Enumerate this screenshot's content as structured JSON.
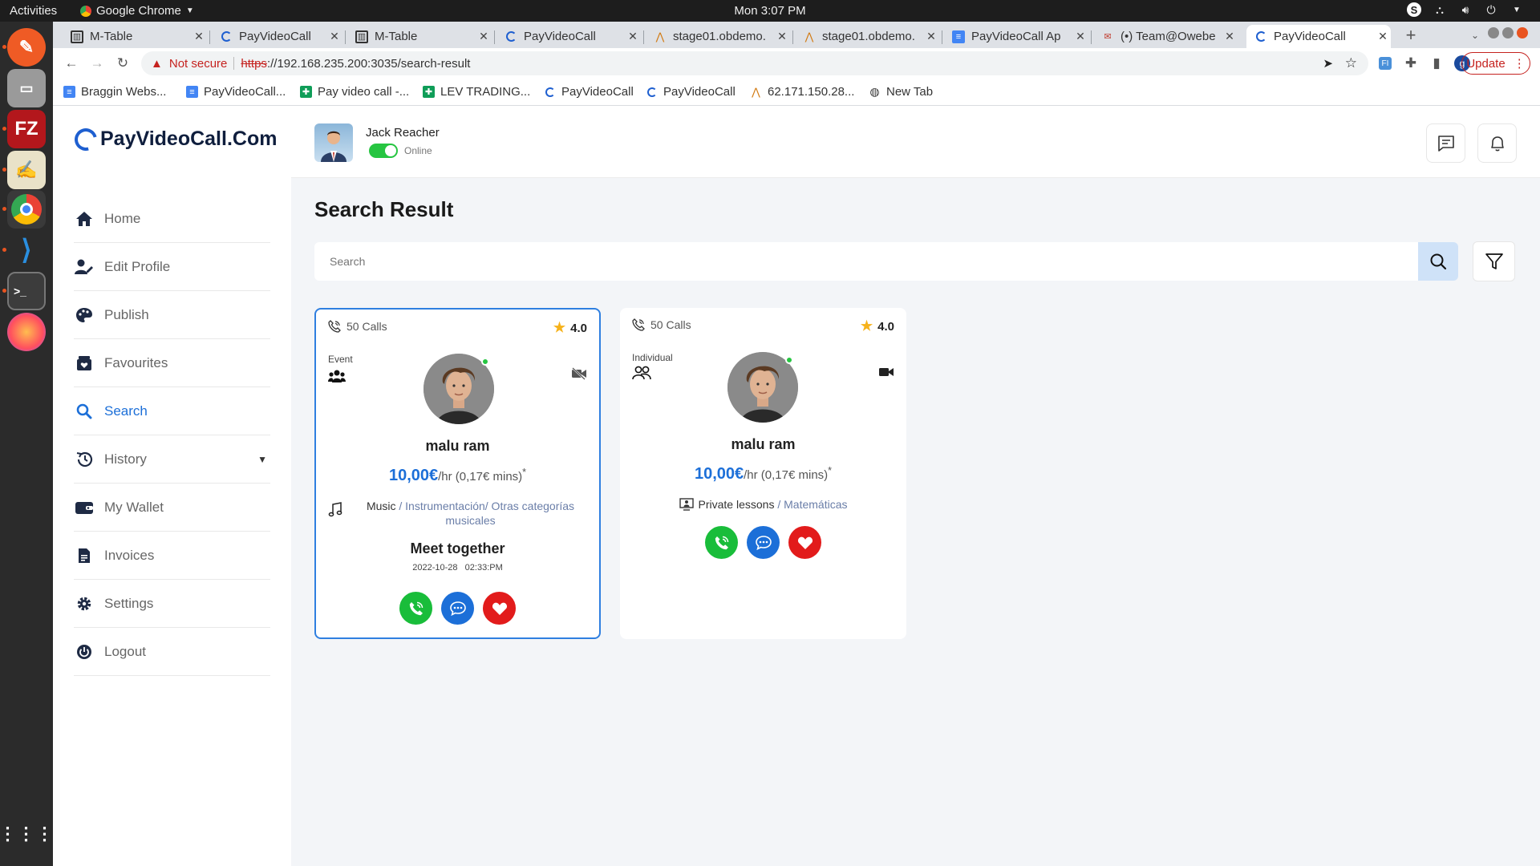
{
  "os": {
    "activities": "Activities",
    "app_name": "Google Chrome",
    "clock": "Mon  3:07 PM"
  },
  "browser": {
    "tabs": [
      {
        "title": "M-Table",
        "icon": "mtable-icon"
      },
      {
        "title": "PayVideoCall",
        "icon": "payvideocall-icon"
      },
      {
        "title": "M-Table",
        "icon": "mtable-icon"
      },
      {
        "title": "PayVideoCall",
        "icon": "payvideocall-icon"
      },
      {
        "title": "stage01.obdemo.",
        "icon": "stage-icon"
      },
      {
        "title": "stage01.obdemo.",
        "icon": "stage-icon"
      },
      {
        "title": "PayVideoCall Ap",
        "icon": "docs-icon"
      },
      {
        "title": "(•) Team@Owebe",
        "icon": "team-icon"
      },
      {
        "title": "PayVideoCall",
        "icon": "payvideocall-icon",
        "active": true
      }
    ],
    "security_label": "Not secure",
    "url_scheme": "https",
    "url_rest": "://192.168.235.200:3035/search-result",
    "update_label": "Update",
    "profile_initial": "g",
    "bookmarks": [
      {
        "label": "Braggin Webs...",
        "icon": "docs-icon"
      },
      {
        "label": "PayVideoCall...",
        "icon": "docs-icon"
      },
      {
        "label": "Pay video call -...",
        "icon": "sheets-icon"
      },
      {
        "label": "LEV TRADING...",
        "icon": "sheets-icon"
      },
      {
        "label": "PayVideoCall",
        "icon": "payvideocall-icon"
      },
      {
        "label": "PayVideoCall",
        "icon": "payvideocall-icon"
      },
      {
        "label": "62.171.150.28...",
        "icon": "stage-icon"
      },
      {
        "label": "New Tab",
        "icon": "globe-icon"
      }
    ]
  },
  "app": {
    "logo": "PayVideoCall.Com",
    "nav": [
      {
        "label": "Home",
        "icon": "home-icon"
      },
      {
        "label": "Edit Profile",
        "icon": "edit-profile-icon"
      },
      {
        "label": "Publish",
        "icon": "palette-icon"
      },
      {
        "label": "Favourites",
        "icon": "favourites-icon"
      },
      {
        "label": "Search",
        "icon": "search-icon",
        "active": true
      },
      {
        "label": "History",
        "icon": "history-icon"
      },
      {
        "label": "My Wallet",
        "icon": "wallet-icon"
      },
      {
        "label": "Invoices",
        "icon": "invoice-icon"
      },
      {
        "label": "Settings",
        "icon": "gear-icon"
      },
      {
        "label": "Logout",
        "icon": "power-icon"
      }
    ],
    "user": {
      "name": "Jack Reacher",
      "status": "Online"
    },
    "page_title": "Search Result",
    "search_placeholder": "Search",
    "accent": "#1c6fd8",
    "cards": [
      {
        "calls": "50 Calls",
        "rating": "4.0",
        "type": "Event",
        "name": "malu ram",
        "price": "10,00€",
        "price_suffix": "/hr (0,17€ mins)",
        "price_mark": "*",
        "category": "Music",
        "subcategory": "/ Instrumentación/ Otras categorías musicales",
        "meeting_title": "Meet together",
        "meeting_date": "2022-10-28",
        "meeting_time": "02:33:PM"
      },
      {
        "calls": "50 Calls",
        "rating": "4.0",
        "type": "Individual",
        "name": "malu ram",
        "price": "10,00€",
        "price_suffix": "/hr (0,17€ mins)",
        "price_mark": "*",
        "category": "Private lessons",
        "subcategory": "/ Matemáticas"
      }
    ]
  }
}
